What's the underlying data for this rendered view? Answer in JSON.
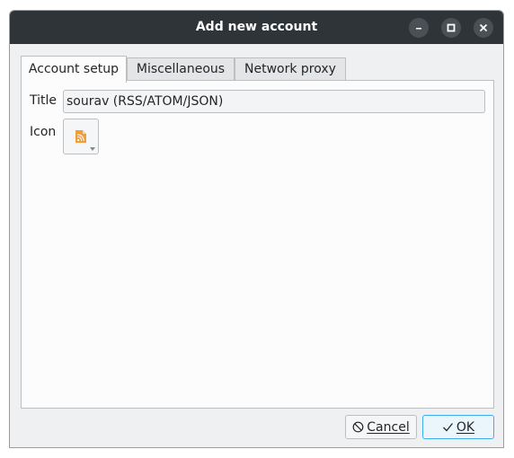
{
  "window": {
    "title": "Add new account",
    "controls": [
      "minimize-icon",
      "maximize-icon",
      "close-icon"
    ]
  },
  "tabs": [
    {
      "label": "Account setup",
      "active": true
    },
    {
      "label": "Miscellaneous",
      "active": false
    },
    {
      "label": "Network proxy",
      "active": false
    }
  ],
  "form": {
    "title_label": "Title",
    "title_value": "sourav (RSS/ATOM/JSON)",
    "icon_label": "Icon",
    "icon_name": "rss-feed-icon"
  },
  "buttons": {
    "cancel": {
      "label": "Cancel",
      "icon": "cancel-icon"
    },
    "ok": {
      "label": "OK",
      "icon": "checkmark-icon"
    }
  },
  "colors": {
    "titlebar": "#2f3438",
    "accent": "#3daee9",
    "rss_orange": "#f39c3a"
  }
}
